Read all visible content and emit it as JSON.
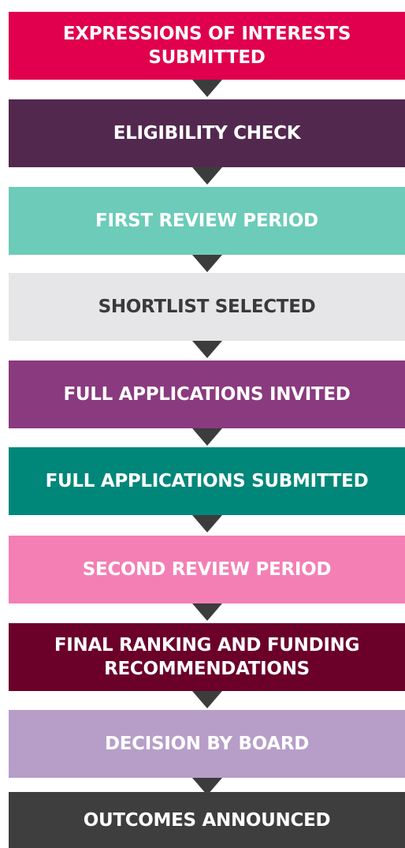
{
  "steps": [
    {
      "label": "EXPRESSIONS OF INTERESTS SUBMITTED",
      "bg": "#e0004d",
      "fg": "#ffffff"
    },
    {
      "label": "ELIGIBILITY CHECK",
      "bg": "#52284f",
      "fg": "#ffffff"
    },
    {
      "label": "FIRST REVIEW PERIOD",
      "bg": "#6ccbb9",
      "fg": "#ffffff"
    },
    {
      "label": "SHORTLIST SELECTED",
      "bg": "#e6e6e8",
      "fg": "#3a3a3a"
    },
    {
      "label": "FULL APPLICATIONS INVITED",
      "bg": "#8a3a7e",
      "fg": "#ffffff"
    },
    {
      "label": "FULL APPLICATIONS SUBMITTED",
      "bg": "#00877a",
      "fg": "#ffffff"
    },
    {
      "label": "SECOND REVIEW PERIOD",
      "bg": "#f47fb5",
      "fg": "#ffffff"
    },
    {
      "label": "FINAL RANKING AND FUNDING RECOMMENDATIONS",
      "bg": "#6b0029",
      "fg": "#ffffff"
    },
    {
      "label": "DECISION BY BOARD",
      "bg": "#b69ec8",
      "fg": "#ffffff"
    },
    {
      "label": "OUTCOMES ANNOUNCED",
      "bg": "#3e3e3e",
      "fg": "#ffffff"
    }
  ],
  "arrow_color": "#3c3c3c"
}
